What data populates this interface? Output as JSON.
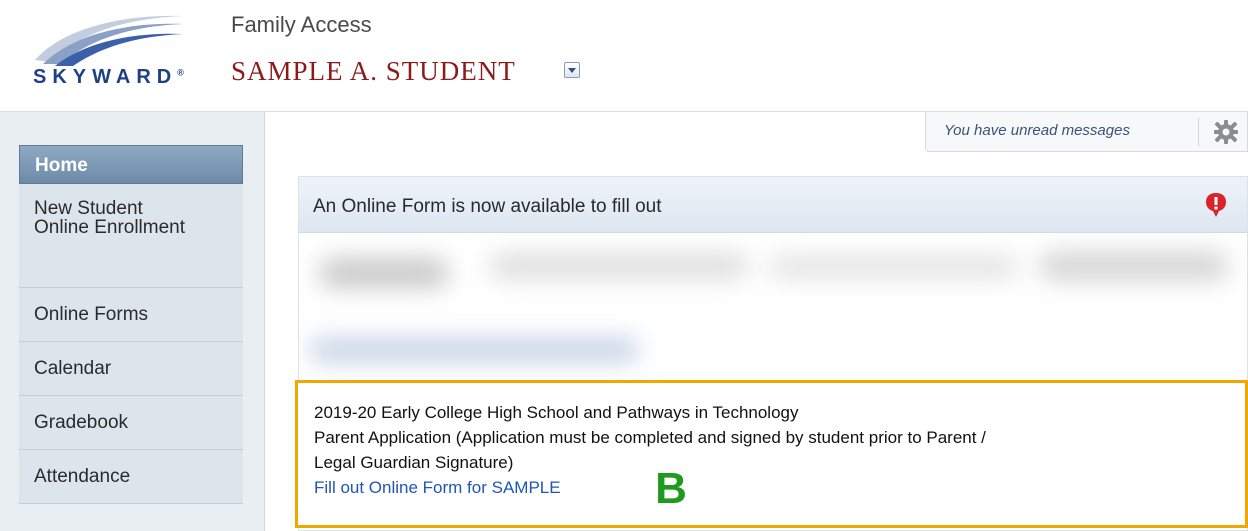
{
  "header": {
    "logo_text": "SKYWARD",
    "logo_mark": "®",
    "app_title": "Family Access",
    "student_name": "SAMPLE A. STUDENT"
  },
  "sidebar": {
    "items": [
      {
        "label": "Home",
        "active": true
      },
      {
        "label": "New Student Online Enrollment"
      },
      {
        "label": "Online Forms"
      },
      {
        "label": "Calendar"
      },
      {
        "label": "Gradebook"
      },
      {
        "label": "Attendance"
      }
    ]
  },
  "messages": {
    "unread_text": "You have unread messages",
    "settings_icon": "gear-icon"
  },
  "panel": {
    "title": "An Online Form is now available to fill out",
    "alert_icon": "alert-icon"
  },
  "form": {
    "line1": "2019-20 Early College High School and Pathways in Technology",
    "line2": "Parent Application (Application must be completed and signed by student prior to Parent /",
    "line3": "Legal Guardian Signature)",
    "link": "Fill out Online Form for SAMPLE",
    "annotation": "B"
  },
  "colors": {
    "accent_border": "#f2a600",
    "annotation_green": "#1f9a1f",
    "link_blue": "#1f56b5",
    "student_name_red": "#8b1a1a"
  }
}
